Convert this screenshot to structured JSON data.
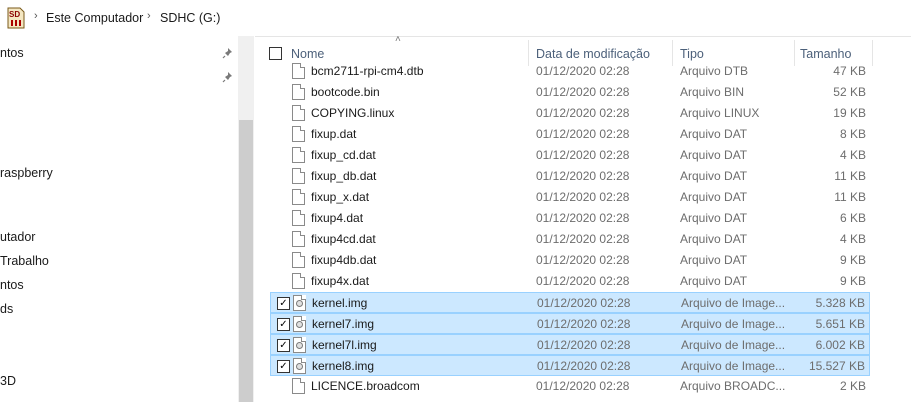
{
  "address": {
    "icon": "sd-card-icon",
    "crumbs": [
      "Este Computador",
      "SDHC (G:)"
    ]
  },
  "nav": {
    "items": [
      "ntos",
      "raspberry",
      "utador",
      "Trabalho",
      "ntos",
      "ds",
      "3D"
    ]
  },
  "header": {
    "name": "Nome",
    "date": "Data de modificação",
    "type": "Tipo",
    "size": "Tamanho"
  },
  "files": [
    {
      "name": "bcm2711-rpi-cm4.dtb",
      "date": "01/12/2020 02:28",
      "type": "Arquivo DTB",
      "size": "47 KB",
      "selected": false,
      "icon": "file-icon"
    },
    {
      "name": "bootcode.bin",
      "date": "01/12/2020 02:28",
      "type": "Arquivo BIN",
      "size": "52 KB",
      "selected": false,
      "icon": "file-icon"
    },
    {
      "name": "COPYING.linux",
      "date": "01/12/2020 02:28",
      "type": "Arquivo LINUX",
      "size": "19 KB",
      "selected": false,
      "icon": "file-icon"
    },
    {
      "name": "fixup.dat",
      "date": "01/12/2020 02:28",
      "type": "Arquivo DAT",
      "size": "8 KB",
      "selected": false,
      "icon": "file-icon"
    },
    {
      "name": "fixup_cd.dat",
      "date": "01/12/2020 02:28",
      "type": "Arquivo DAT",
      "size": "4 KB",
      "selected": false,
      "icon": "file-icon"
    },
    {
      "name": "fixup_db.dat",
      "date": "01/12/2020 02:28",
      "type": "Arquivo DAT",
      "size": "11 KB",
      "selected": false,
      "icon": "file-icon"
    },
    {
      "name": "fixup_x.dat",
      "date": "01/12/2020 02:28",
      "type": "Arquivo DAT",
      "size": "11 KB",
      "selected": false,
      "icon": "file-icon"
    },
    {
      "name": "fixup4.dat",
      "date": "01/12/2020 02:28",
      "type": "Arquivo DAT",
      "size": "6 KB",
      "selected": false,
      "icon": "file-icon"
    },
    {
      "name": "fixup4cd.dat",
      "date": "01/12/2020 02:28",
      "type": "Arquivo DAT",
      "size": "4 KB",
      "selected": false,
      "icon": "file-icon"
    },
    {
      "name": "fixup4db.dat",
      "date": "01/12/2020 02:28",
      "type": "Arquivo DAT",
      "size": "9 KB",
      "selected": false,
      "icon": "file-icon"
    },
    {
      "name": "fixup4x.dat",
      "date": "01/12/2020 02:28",
      "type": "Arquivo DAT",
      "size": "9 KB",
      "selected": false,
      "icon": "file-icon"
    },
    {
      "name": "kernel.img",
      "date": "01/12/2020 02:28",
      "type": "Arquivo de Image...",
      "size": "5.328 KB",
      "selected": true,
      "icon": "disc-image-icon"
    },
    {
      "name": "kernel7.img",
      "date": "01/12/2020 02:28",
      "type": "Arquivo de Image...",
      "size": "5.651 KB",
      "selected": true,
      "icon": "disc-image-icon"
    },
    {
      "name": "kernel7l.img",
      "date": "01/12/2020 02:28",
      "type": "Arquivo de Image...",
      "size": "6.002 KB",
      "selected": true,
      "icon": "disc-image-icon"
    },
    {
      "name": "kernel8.img",
      "date": "01/12/2020 02:28",
      "type": "Arquivo de Image...",
      "size": "15.527 KB",
      "selected": true,
      "icon": "disc-image-icon"
    },
    {
      "name": "LICENCE.broadcom",
      "date": "01/12/2020 02:28",
      "type": "Arquivo BROADC...",
      "size": "2 KB",
      "selected": false,
      "icon": "file-icon"
    }
  ],
  "colors": {
    "selection_bg": "#cce8ff",
    "selection_border": "#99d1ff",
    "header_text": "#4c607a"
  }
}
